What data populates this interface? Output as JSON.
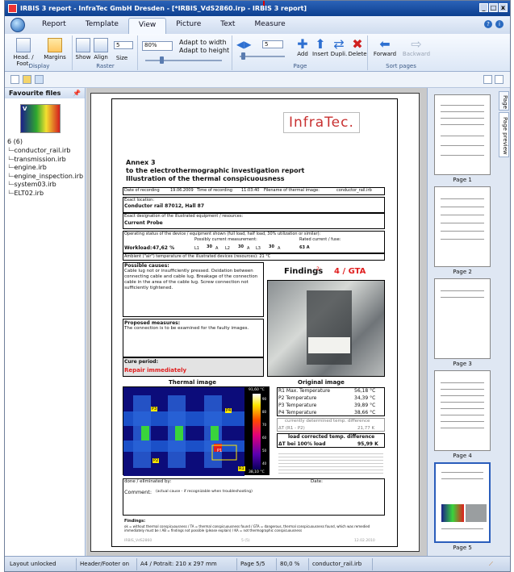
{
  "window": {
    "title": "IRBIS 3 report - InfraTec GmbH Dresden - [*IRBIS_VdS2860.irp - IRBIS 3 report]"
  },
  "tabs": [
    "Report",
    "Template",
    "View",
    "Picture",
    "Text",
    "Measure"
  ],
  "active_tab": "View",
  "ribbon": {
    "display": {
      "label": "Display",
      "buttons": [
        "Head. / Foot.",
        "Margins"
      ]
    },
    "raster": {
      "label": "Raster",
      "buttons": [
        "Show",
        "Align",
        "Size"
      ],
      "size_value": "5"
    },
    "zoom": {
      "value": "80%",
      "fit_width": "Adapt to width",
      "fit_height": "Adapt to height"
    },
    "page": {
      "label": "Page",
      "spin_value": "5",
      "buttons": [
        "Add",
        "Insert",
        "Dupli.",
        "Delete"
      ]
    },
    "sort": {
      "label": "Sort pages",
      "buttons": [
        "Forward",
        "Backward"
      ]
    }
  },
  "favourites": {
    "title": "Favourite files",
    "thumb_mark": "V",
    "count": "6 (6)",
    "files": [
      "conductor_rail.irb",
      "transmission.irb",
      "engine.irb",
      "engine_inspection.irb",
      "system03.irb",
      "ELT02.irb"
    ]
  },
  "document": {
    "logo": "InfraTec.",
    "heading": [
      "Annex 3",
      "to the electrothermographic investigation report",
      "Illustration of the thermal conspicuousness"
    ],
    "meta": {
      "date_label": "Date of recording",
      "date": "19.06.2009",
      "time_label": "Time of recording",
      "time": "11:03:40",
      "file_label": "Filename of thermal image:",
      "file": "conductor_rail.irb"
    },
    "location_label": "Exact location:",
    "location": "Conductor rail 87012, Hall 87",
    "designation_label": "Exact designation of the illustrated equipment / resources:",
    "designation": "Current Probe",
    "operating_label": "Operating status of the device / equipment shown (full load, half load, 30% utilization or similar):",
    "possibly_label": "Possibly current measurement:",
    "rated_label": "Rated current / fuse:",
    "workload_label": "Workload:",
    "workload": "47,62 %",
    "l1": "L1",
    "l1v": "30",
    "l2": "L2",
    "l2v": "30",
    "l3": "L3",
    "l3v": "30",
    "amp": "A",
    "rated": "63 A",
    "ambient": "Ambient (\"air\") temperature of the illustrated devices (resources):   21 °C",
    "causes_label": "Possible causes:",
    "causes": "Cable lug not or insufficiently pressed. Oxidation between connecting cable and cable lug. Breakage of the connection cable in the area of the cable lug. Screw connection not sufficiently tightened.",
    "findings_label": "Findings",
    "findings_value": "4 / GTA",
    "measures_label": "Proposed measures:",
    "measures": "The connection is to be examined for the faulty images.",
    "cure_label": "Cure period:",
    "cure": "Repair immediately",
    "thermal_label": "Thermal image",
    "original_label": "Original image",
    "scale_max": "91,60 °C",
    "scale_min": "38,10 °C",
    "scale_ticks": [
      "90",
      "80",
      "70",
      "60",
      "50",
      "40"
    ],
    "markers": [
      "P3",
      "P4",
      "P2",
      "R1",
      "P1"
    ],
    "temps": [
      [
        "R1 Max. Temperature",
        "56,18 °C"
      ],
      [
        "P2 Temperature",
        "34,39 °C"
      ],
      [
        "P3 Temperature",
        "39,89 °C"
      ],
      [
        "P4 Temperature",
        "38,66 °C"
      ]
    ],
    "currently": "currently determined temp. difference",
    "delta_label": "ΔT (R1 - P2)",
    "delta": "21,77 K",
    "load_corr": "load corrected temp. difference",
    "at100_label": "ΔT bei 100% load",
    "at100": "95,99 K",
    "done_label": "done / eliminated by:",
    "date2_label": "Date:",
    "comment_label": "Comment:",
    "comment": "(actual cause - if recognizable when troubleshooting)",
    "footer_title": "Findings:",
    "footer_text": "ok = without thermal conspicuousness / TA = thermal conspicuousness found / GTA = dangerous, thermal conspicuousness found, which was remedied immediately must be / AB = findings not possible (please explain) / KA = not thermographic conspicuousness",
    "footer_left": "IRBIS_VdS2860",
    "footer_mid": "5 (5)",
    "footer_right": "12.02.2010"
  },
  "thumbnails": [
    {
      "label": "Page 1"
    },
    {
      "label": "Page 2"
    },
    {
      "label": "Page 3"
    },
    {
      "label": "Page 4"
    },
    {
      "label": "Page 5"
    }
  ],
  "side_tabs": [
    "Page",
    "Page preview"
  ],
  "status": {
    "layout": "Layout unlocked",
    "header_footer": "Header/Footer on",
    "paper": "A4 / Potrait: 210 x 297 mm",
    "page": "Page 5/5",
    "zoom": "80,0 %",
    "file": "conductor_rail.irb"
  },
  "colors": {
    "accent": "#2b63b8",
    "danger": "#e02020"
  }
}
